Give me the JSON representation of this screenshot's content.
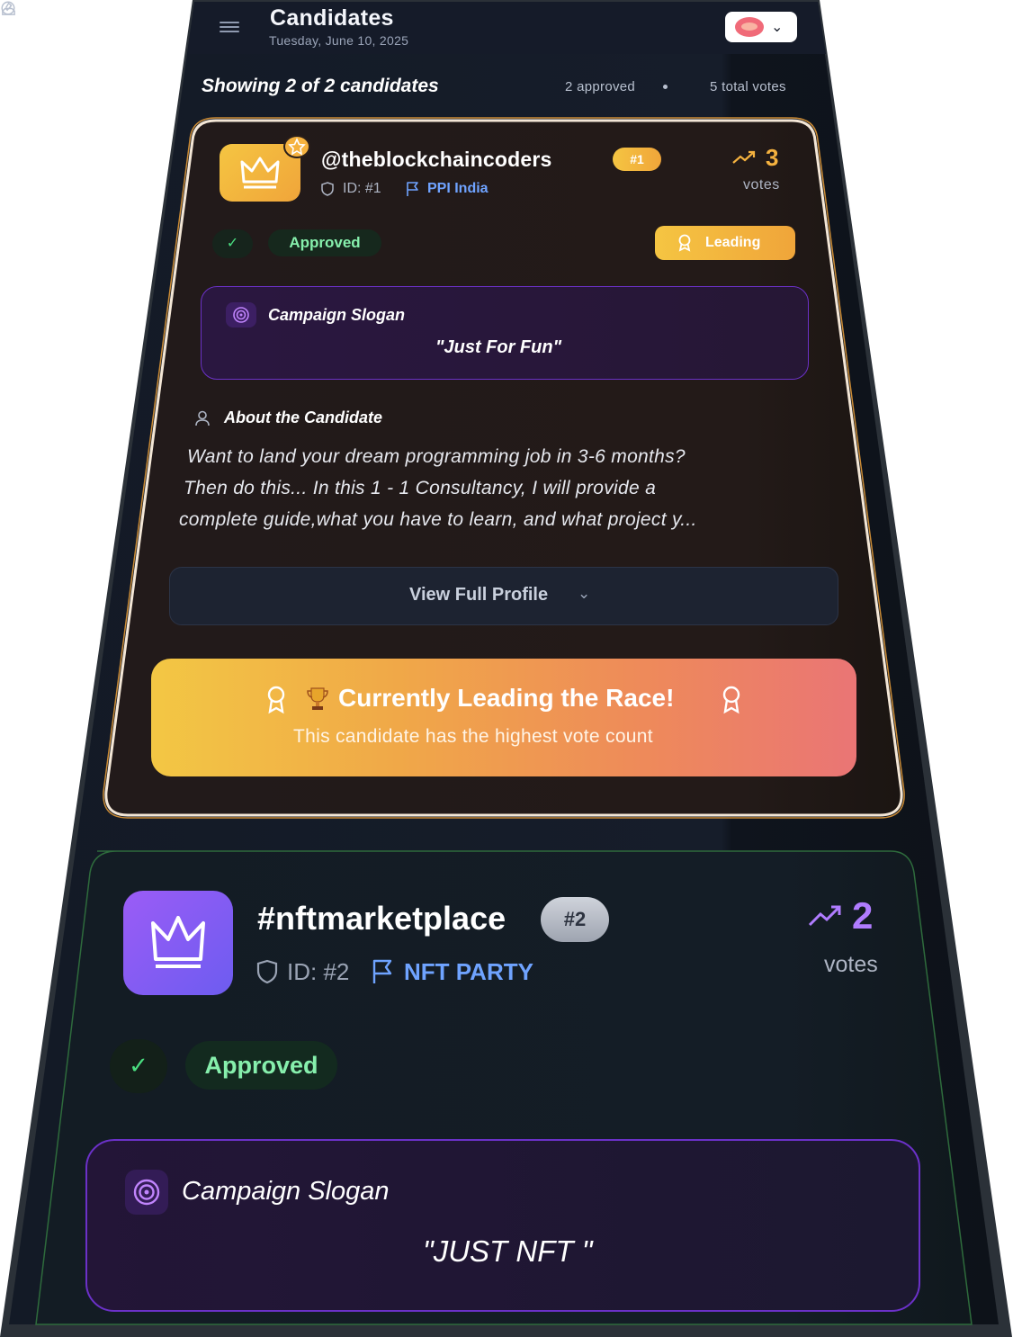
{
  "header": {
    "title": "Candidates",
    "date": "Tuesday, June 10, 2025"
  },
  "summary": {
    "showing": "Showing 2 of 2 candidates",
    "approved": "2 approved",
    "total_votes": "5 total votes"
  },
  "colors": {
    "background": "#111827",
    "gold": "#f5b23f",
    "purple": "#9b5cf6",
    "approved_green": "#86efac",
    "party_blue": "#6fa3ff"
  },
  "candidates": [
    {
      "name": "@theblockchaincoders",
      "rank": "#1",
      "id": "ID: #1",
      "party": "PPI India",
      "votes": "3",
      "votes_label": "votes",
      "status": "Approved",
      "leading_badge": "Leading",
      "slogan_title": "Campaign Slogan",
      "slogan": "\"Just For Fun\"",
      "about_title": "About the Candidate",
      "about_lines": [
        "Want to land your dream programming job in 3-6 months?",
        "Then do this... In this 1 - 1 Consultancy, I will provide a",
        "complete guide,what you have to learn, and what project y..."
      ],
      "view_button": "View Full Profile",
      "banner_title": "Currently Leading the Race!",
      "banner_subtitle": "This candidate has the highest vote count"
    },
    {
      "name": "#nftmarketplace",
      "rank": "#2",
      "id": "ID: #2",
      "party": "NFT PARTY",
      "votes": "2",
      "votes_label": "votes",
      "status": "Approved",
      "slogan_title": "Campaign Slogan",
      "slogan": "\"JUST NFT \""
    }
  ],
  "icons": {
    "menu": "menu-icon",
    "approved": "check-circle-icon",
    "votes": "ballot-box-icon",
    "avatar": "crown-icon",
    "id": "shield-icon",
    "party": "flag-icon",
    "trend": "trending-up-icon",
    "leading": "award-icon",
    "slogan": "target-icon",
    "about": "user-icon",
    "trophy": "trophy-icon",
    "chevron": "chevron-down-icon"
  }
}
